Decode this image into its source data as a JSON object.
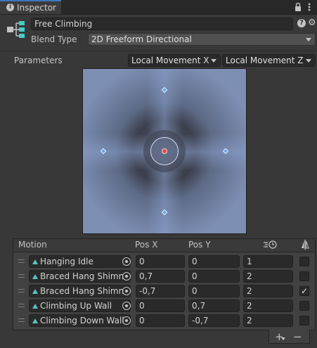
{
  "tab": {
    "title": "Inspector",
    "icon": "info-icon"
  },
  "header_icons": [
    "lock-icon",
    "more-options-icon"
  ],
  "node": {
    "icon": "blend-tree-icon",
    "name": "Free Climbing",
    "blend_type_label": "Blend Type",
    "blend_type": "2D Freeform Directional",
    "help_icon": "help-icon",
    "settings_icon": "gear-icon"
  },
  "parameters": {
    "label": "Parameters",
    "x_param": "Local Movement X",
    "y_param": "Local Movement Z"
  },
  "graph": {
    "points": [
      {
        "motion": "Hanging Idle",
        "x": 0,
        "y": 0,
        "center": true
      },
      {
        "motion": "Braced Hang Shimmy",
        "x": 0.7,
        "y": 0
      },
      {
        "motion": "Braced Hang Shimmy",
        "x": -0.7,
        "y": 0
      },
      {
        "motion": "Climbing Up Wall",
        "x": 0,
        "y": 0.7
      },
      {
        "motion": "Climbing Down Wall",
        "x": 0,
        "y": -0.7
      }
    ]
  },
  "table": {
    "headers": {
      "motion": "Motion",
      "pos_x": "Pos X",
      "pos_y": "Pos Y",
      "speed_icon": "time-scale-icon",
      "mirror_icon": "mirror-icon"
    },
    "rows": [
      {
        "motion": "Hanging Idle",
        "pos_x": "0",
        "pos_y": "0",
        "speed": "1",
        "mirror": false
      },
      {
        "motion": "Braced Hang Shimn",
        "pos_x": "0,7",
        "pos_y": "0",
        "speed": "2",
        "mirror": false
      },
      {
        "motion": "Braced Hang Shimn",
        "pos_x": "-0,7",
        "pos_y": "0",
        "speed": "2",
        "mirror": true
      },
      {
        "motion": "Climbing Up Wall",
        "pos_x": "0",
        "pos_y": "0,7",
        "speed": "2",
        "mirror": false
      },
      {
        "motion": "Climbing Down Wall",
        "pos_x": "0",
        "pos_y": "-0,7",
        "speed": "2",
        "mirror": false
      }
    ],
    "add_label": "+",
    "remove_label": "−"
  },
  "colors": {
    "accent": "#3a79bb",
    "background": "#383838",
    "field": "#2a2a2a",
    "point": "#6aa4e6",
    "center_point": "#e05050",
    "clip_icon": "#5fbfc6"
  }
}
